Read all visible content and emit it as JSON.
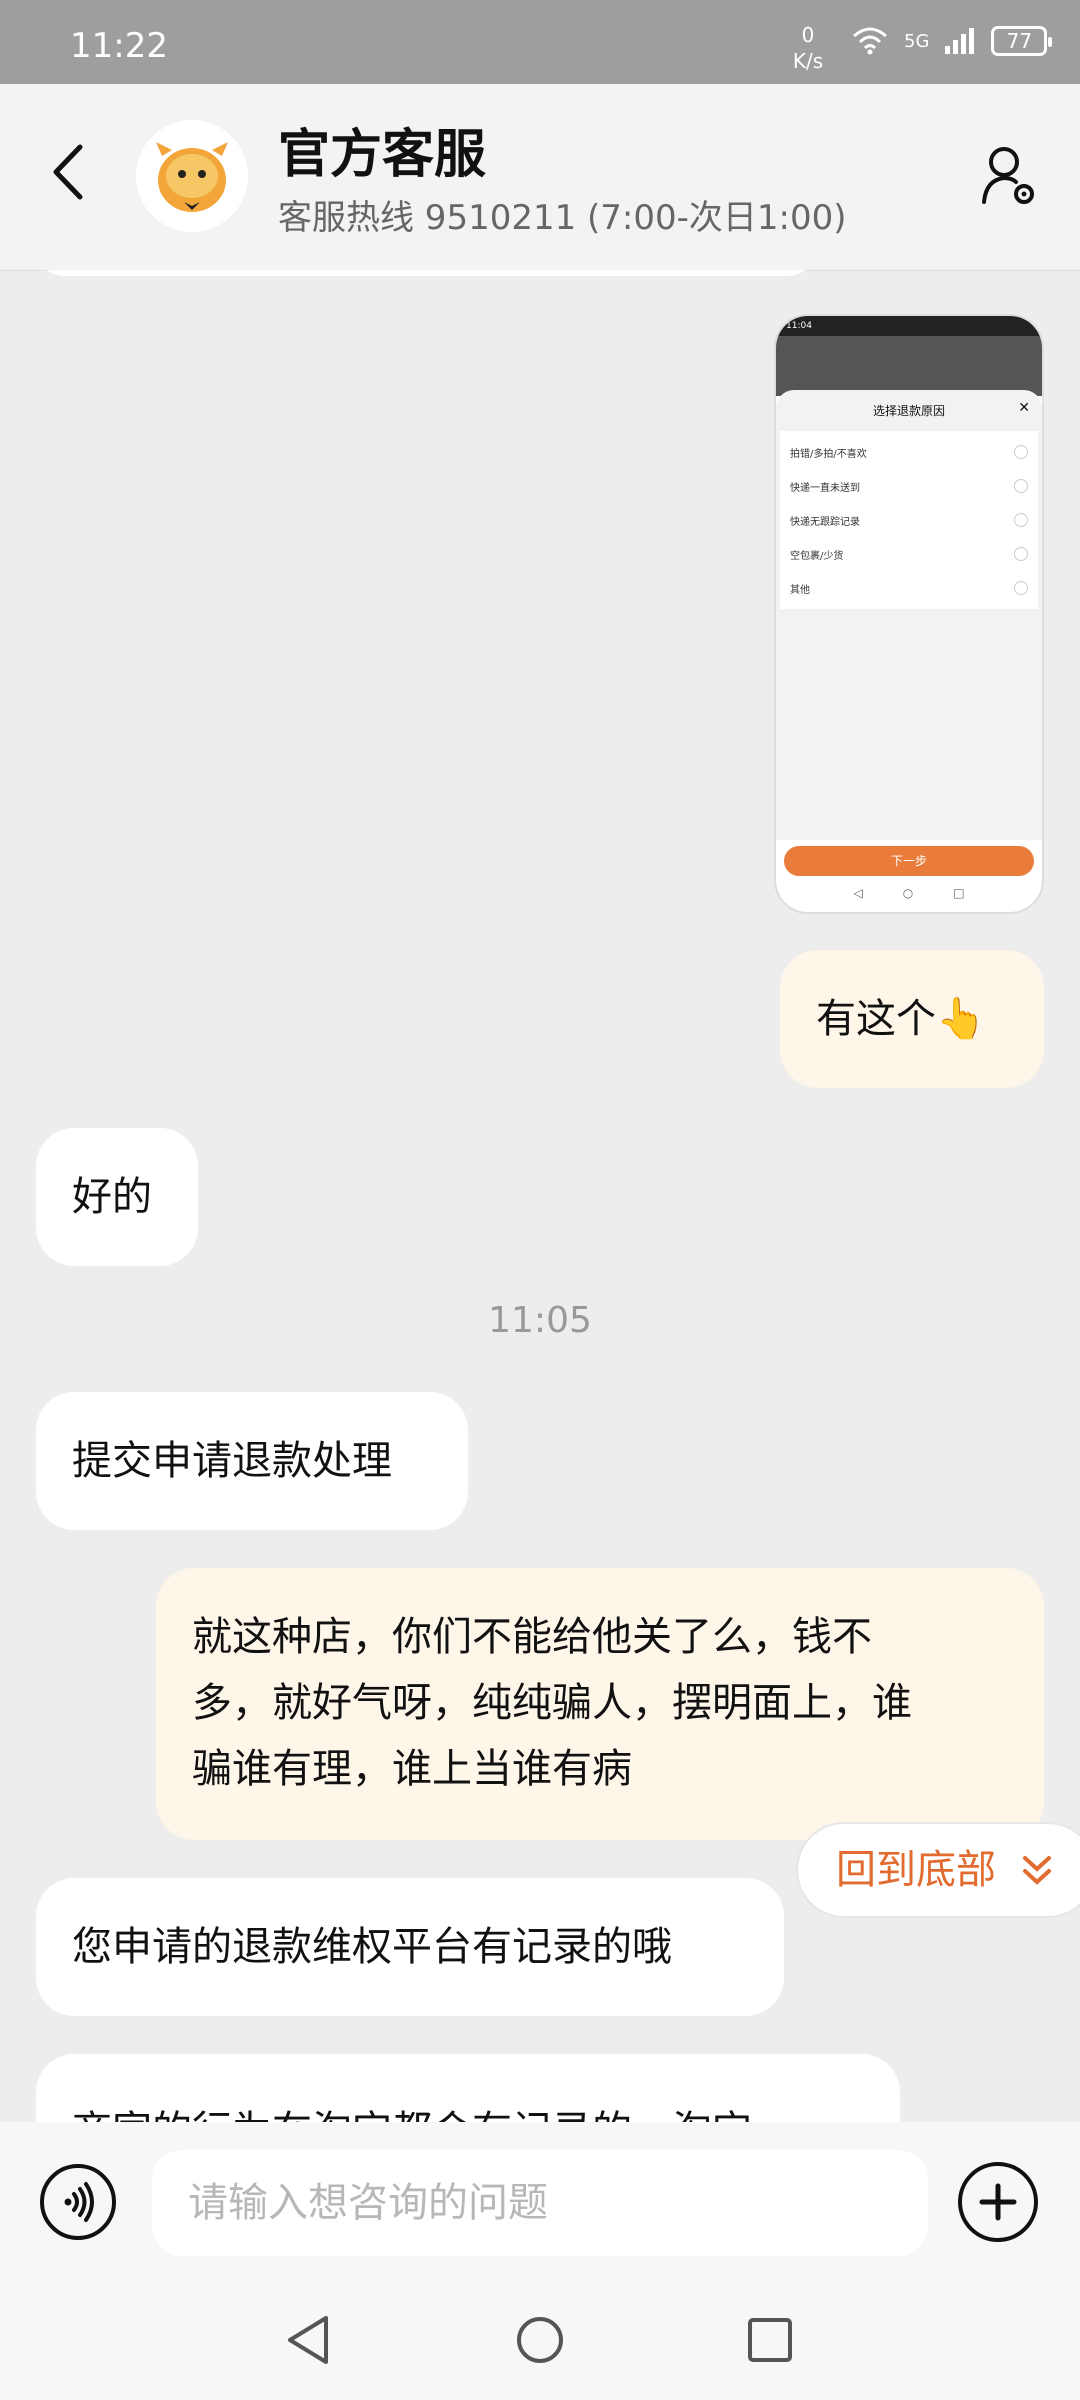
{
  "status_bar": {
    "time": "11:22",
    "net_speed_value": "0",
    "net_speed_unit": "K/s",
    "signal_label": "5G",
    "battery": "77"
  },
  "header": {
    "title": "官方客服",
    "subtitle": "客服热线 9510211 (7:00-次日1:00)"
  },
  "screenshot_thumb": {
    "time": "11:04",
    "sheet_title": "选择退款原因",
    "options": [
      "拍错/多拍/不喜欢",
      "快递一直未送到",
      "快递无跟踪记录",
      "空包裹/少货",
      "其他"
    ],
    "next_label": "下一步"
  },
  "messages": [
    {
      "side": "right",
      "text": "有这个",
      "emoji": "👆"
    },
    {
      "side": "left",
      "text": "好的"
    },
    {
      "side": "left",
      "text": "提交申请退款处理"
    },
    {
      "side": "right",
      "lines": [
        "就这种店，你们不能给他关了么，钱不",
        "多，就好气呀，纯纯骗人，摆明面上，谁",
        "骗谁有理，谁上当谁有病"
      ]
    },
    {
      "side": "left",
      "text": "您申请的退款维权平台有记录的哦"
    },
    {
      "side": "left",
      "text": "商家的行为在淘宝都会有记录的，淘宝"
    }
  ],
  "timestamp": "11:05",
  "jump_to_bottom": "回到底部",
  "input": {
    "placeholder": "请输入想咨询的问题",
    "value": ""
  },
  "icons": {
    "back": "back-arrow-icon",
    "settings": "user-settings-icon",
    "voice": "voice-icon",
    "plus": "plus-icon"
  },
  "colors": {
    "accent": "#e26b2f",
    "outgoing_bubble": "#fff6ea",
    "incoming_bubble": "#ffffff",
    "background": "#ededed"
  }
}
